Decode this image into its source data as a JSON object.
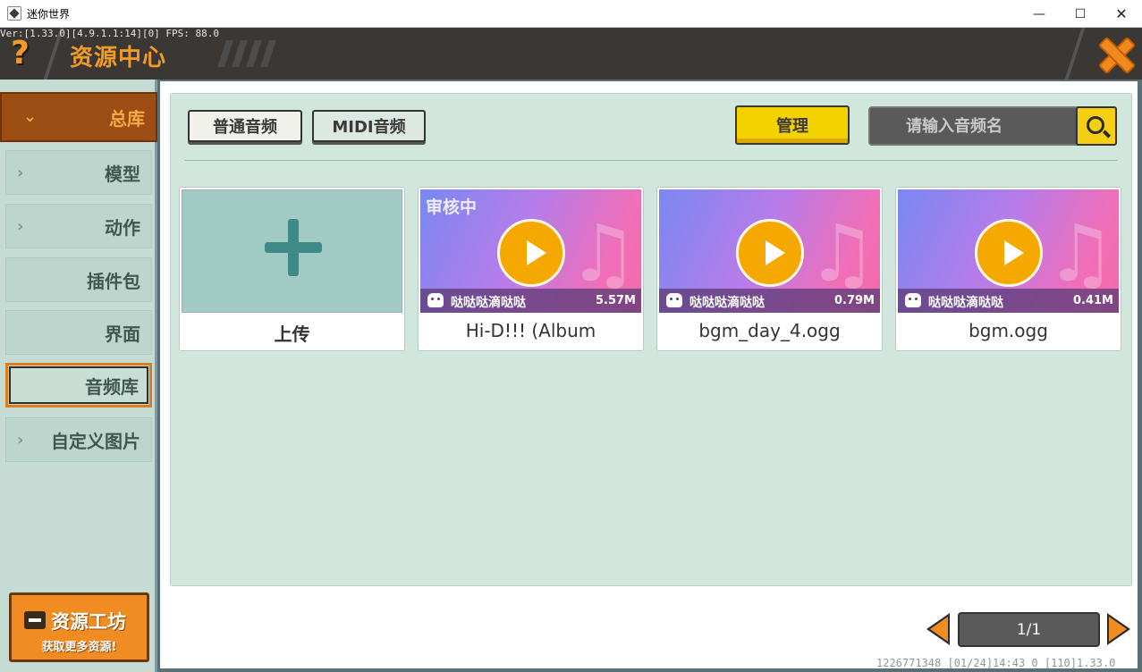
{
  "window": {
    "title": "迷你世界"
  },
  "debug_line": "Ver:[1.33.0][4.9.1.1:14][0] FPS: 88.0",
  "header": {
    "question_mark": "?",
    "title": "资源中心"
  },
  "sidebar": {
    "items": [
      {
        "label": "总库",
        "chevron": "⌄"
      },
      {
        "label": "模型",
        "chevron": "›"
      },
      {
        "label": "动作",
        "chevron": "›"
      },
      {
        "label": "插件包"
      },
      {
        "label": "界面"
      },
      {
        "label": "音频库"
      },
      {
        "label": "自定义图片",
        "chevron": "›"
      }
    ],
    "workshop": {
      "title": "资源工坊",
      "subtitle": "获取更多资源!"
    }
  },
  "toolbar": {
    "tab_normal": "普通音频",
    "tab_midi": "MIDI音频",
    "manage": "管理",
    "search_placeholder": "请输入音频名"
  },
  "cards": [
    {
      "name": "上传"
    },
    {
      "name": "Hi-D!!! (Album",
      "author": "哒哒哒滴哒哒",
      "size": "5.57M",
      "badge": "审核中"
    },
    {
      "name": "bgm_day_4.ogg",
      "author": "哒哒哒滴哒哒",
      "size": "0.79M"
    },
    {
      "name": "bgm.ogg",
      "author": "哒哒哒滴哒哒",
      "size": "0.41M"
    }
  ],
  "pagination": {
    "page": "1/1"
  },
  "footer": "1226771348   [01/24]14:43 0   [110]1.33.0",
  "colors": {
    "accent_orange": "#f08c22",
    "manage_yellow": "#f4d200",
    "panel_bg": "#d1e6dc"
  },
  "icons": [
    "minimize-icon",
    "maximize-icon",
    "close-icon",
    "search-icon",
    "play-icon",
    "music-note-icon",
    "plus-icon",
    "shop-icon",
    "robot-icon",
    "arrow-left-icon",
    "arrow-right-icon"
  ]
}
